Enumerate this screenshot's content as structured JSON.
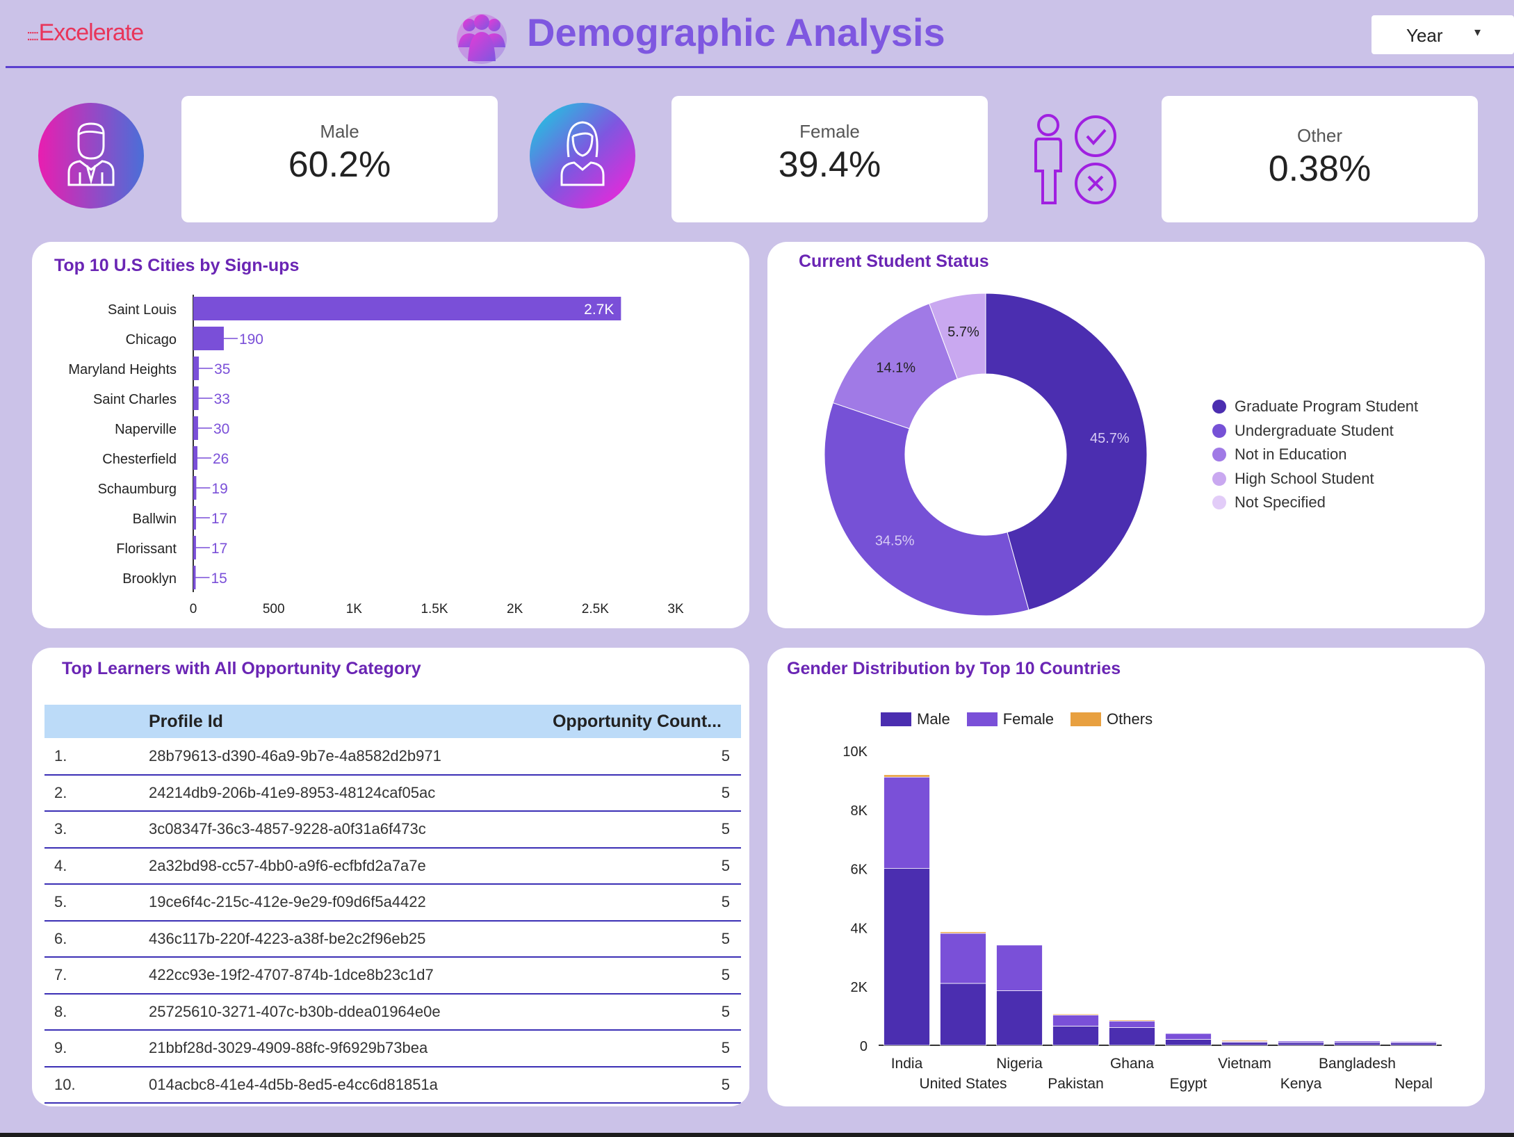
{
  "header": {
    "logo_text": "Excelerate",
    "logo_dots": ":::::",
    "title": "Demographic Analysis",
    "year_filter": {
      "label": "Year",
      "arrow": "▾"
    }
  },
  "kpis": [
    {
      "label": "Male",
      "value": "60.2%",
      "icon": "male-avatar-icon"
    },
    {
      "label": "Female",
      "value": "39.4%",
      "icon": "female-avatar-icon"
    },
    {
      "label": "Other",
      "value": "0.38%",
      "icon": "person-check-cross-icon"
    }
  ],
  "colors": {
    "accent": "#7e57e0",
    "title_purple": "#6a25b4",
    "bar": "#7a4fd8",
    "male": "#4b2eb0",
    "female": "#7a50d8",
    "others": "#e8a040",
    "table_header": "#bcdbf8",
    "background": "#cbc2e8"
  },
  "cities_chart": {
    "title": "Top 10 U.S Cities by Sign-ups",
    "chart_data": {
      "type": "bar",
      "orientation": "horizontal",
      "categories": [
        "Saint Louis",
        "Chicago",
        "Maryland Heights",
        "Saint Charles",
        "Naperville",
        "Chesterfield",
        "Schaumburg",
        "Ballwin",
        "Florissant",
        "Brooklyn"
      ],
      "values": [
        2660,
        190,
        35,
        33,
        30,
        26,
        19,
        17,
        17,
        15
      ],
      "data_labels": [
        "2.7K",
        "190",
        "35",
        "33",
        "30",
        "26",
        "19",
        "17",
        "17",
        "15"
      ],
      "xlim": [
        0,
        3000
      ],
      "x_ticks": [
        "0",
        "500",
        "1K",
        "1.5K",
        "2K",
        "2.5K",
        "3K"
      ],
      "x_tick_values": [
        0,
        500,
        1000,
        1500,
        2000,
        2500,
        3000
      ]
    }
  },
  "status_chart": {
    "title": "Current Student Status",
    "chart_data": {
      "type": "pie",
      "donut": true,
      "labels": [
        "Graduate Program Student",
        "Undergraduate Student",
        "Not in Education",
        "High School Student",
        "Not Specified"
      ],
      "values": [
        45.7,
        34.5,
        14.1,
        5.7,
        0
      ],
      "slice_labels": [
        "45.7%",
        "34.5%",
        "14.1%",
        "5.7%",
        ""
      ],
      "colors": [
        "#4b2eb0",
        "#7651d6",
        "#a07ae6",
        "#c9a8f0",
        "#e2ccf8"
      ],
      "legend_position": "right"
    }
  },
  "learners_table": {
    "title": "Top Learners with All Opportunity Category",
    "columns": [
      "Profile Id",
      "Opportunity Count..."
    ],
    "rows": [
      {
        "index": "1.",
        "id": "28b79613-d390-46a9-9b7e-4a8582d2b971",
        "count": "5"
      },
      {
        "index": "2.",
        "id": "24214db9-206b-41e9-8953-48124caf05ac",
        "count": "5"
      },
      {
        "index": "3.",
        "id": "3c08347f-36c3-4857-9228-a0f31a6f473c",
        "count": "5"
      },
      {
        "index": "4.",
        "id": "2a32bd98-cc57-4bb0-a9f6-ecfbfd2a7a7e",
        "count": "5"
      },
      {
        "index": "5.",
        "id": "19ce6f4c-215c-412e-9e29-f09d6f5a4422",
        "count": "5"
      },
      {
        "index": "6.",
        "id": "436c117b-220f-4223-a38f-be2c2f96eb25",
        "count": "5"
      },
      {
        "index": "7.",
        "id": "422cc93e-19f2-4707-874b-1dce8b23c1d7",
        "count": "5"
      },
      {
        "index": "8.",
        "id": "25725610-3271-407c-b30b-ddea01964e0e",
        "count": "5"
      },
      {
        "index": "9.",
        "id": "21bbf28d-3029-4909-88fc-9f6929b73bea",
        "count": "5"
      },
      {
        "index": "10.",
        "id": "014acbc8-41e4-4d5b-8ed5-e4cc6d81851a",
        "count": "5"
      }
    ]
  },
  "gender_chart": {
    "title": "Gender Distribution by Top 10 Countries",
    "chart_data": {
      "type": "bar",
      "stacked": true,
      "categories": [
        "India",
        "United States",
        "Nigeria",
        "Pakistan",
        "Ghana",
        "Egypt",
        "Vietnam",
        "Kenya",
        "Bangladesh",
        "Nepal"
      ],
      "series": [
        {
          "name": "Male",
          "values": [
            6000,
            2100,
            1850,
            650,
            600,
            200,
            100,
            90,
            90,
            80
          ]
        },
        {
          "name": "Female",
          "values": [
            3100,
            1700,
            1550,
            400,
            250,
            200,
            60,
            50,
            50,
            40
          ]
        },
        {
          "name": "Others",
          "values": [
            80,
            50,
            0,
            10,
            5,
            0,
            5,
            0,
            0,
            0
          ]
        }
      ],
      "ylim": [
        0,
        10000
      ],
      "y_ticks": [
        "0",
        "2K",
        "4K",
        "6K",
        "8K",
        "10K"
      ],
      "y_tick_values": [
        0,
        2000,
        4000,
        6000,
        8000,
        10000
      ],
      "legend_position": "top-left"
    }
  }
}
